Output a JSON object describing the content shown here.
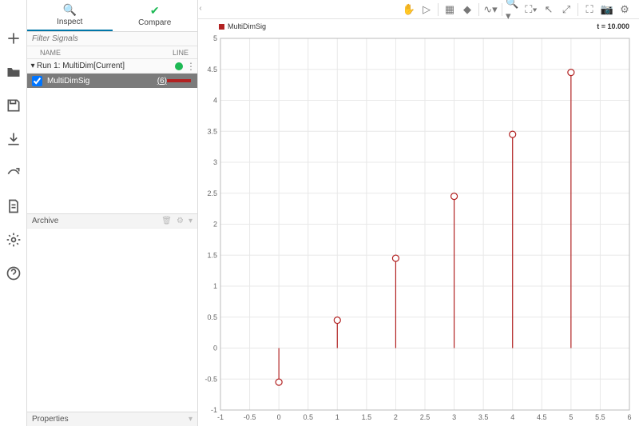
{
  "tabs": {
    "inspect": "Inspect",
    "compare": "Compare"
  },
  "filter": {
    "placeholder": "Filter Signals"
  },
  "columns": {
    "name": "NAME",
    "line": "LINE"
  },
  "run": {
    "label": "Run 1: MultiDim[Current]"
  },
  "signal": {
    "name": "MultiDimSig",
    "count": "(6)"
  },
  "sections": {
    "archive": "Archive",
    "properties": "Properties"
  },
  "plot": {
    "legend": "MultiDimSig",
    "timestamp": "t = 10.000"
  },
  "chart_data": {
    "type": "stem",
    "title": "MultiDimSig",
    "xlabel": "",
    "ylabel": "",
    "xlim": [
      -1.0,
      6.0
    ],
    "ylim": [
      -1.0,
      5.0
    ],
    "xticks": [
      -1.0,
      -0.5,
      0.0,
      0.5,
      1.0,
      1.5,
      2.0,
      2.5,
      3.0,
      3.5,
      4.0,
      4.5,
      5.0,
      5.5,
      6.0
    ],
    "yticks": [
      -1.0,
      -0.5,
      0.0,
      0.5,
      1.0,
      1.5,
      2.0,
      2.5,
      3.0,
      3.5,
      4.0,
      4.5,
      5.0
    ],
    "x": [
      0,
      1,
      2,
      3,
      4,
      5
    ],
    "y": [
      -0.55,
      0.45,
      1.45,
      2.45,
      3.45,
      4.45
    ],
    "series_color": "#b22222"
  }
}
